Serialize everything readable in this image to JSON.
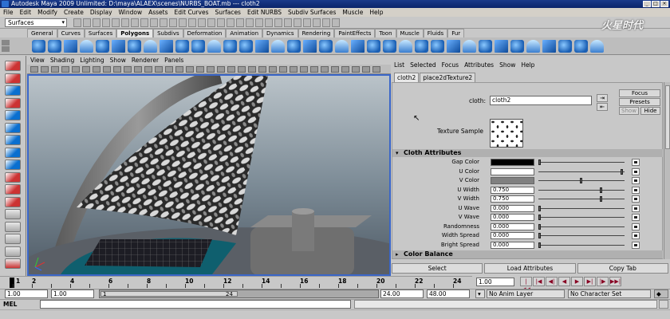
{
  "window": {
    "title": "Autodesk Maya 2009 Unlimited: D:\\maya\\ALAEX\\scenes\\NURBS_BOAT.mb  ---  cloth2"
  },
  "main_menu": [
    "File",
    "Edit",
    "Modify",
    "Create",
    "Display",
    "Window",
    "Assets",
    "Edit Curves",
    "Surfaces",
    "Edit NURBS",
    "Subdiv Surfaces",
    "Muscle",
    "Help"
  ],
  "menu_set": "Surfaces",
  "logo_text": "火星时代",
  "shelf_tabs": [
    "General",
    "Curves",
    "Surfaces",
    "Polygons",
    "Subdivs",
    "Deformation",
    "Animation",
    "Dynamics",
    "Rendering",
    "PaintEffects",
    "Toon",
    "Muscle",
    "Fluids",
    "Fur"
  ],
  "shelf_active": "Polygons",
  "panel_menu": [
    "View",
    "Shading",
    "Lighting",
    "Show",
    "Renderer",
    "Panels"
  ],
  "attr_editor": {
    "menu": [
      "List",
      "Selected",
      "Focus",
      "Attributes",
      "Show",
      "Help"
    ],
    "tabs": [
      "cloth2",
      "place2dTexture2"
    ],
    "active_tab": "cloth2",
    "node_label": "cloth:",
    "node_name": "cloth2",
    "buttons": {
      "focus": "Focus",
      "presets": "Presets",
      "show": "Show",
      "hide": "Hide"
    },
    "texture_sample_label": "Texture Sample",
    "sections": {
      "cloth_attributes": "Cloth Attributes",
      "color_balance": "Color Balance"
    },
    "attributes": [
      {
        "label": "Gap Color",
        "type": "color",
        "color": "#000000",
        "slider": 0.0
      },
      {
        "label": "U Color",
        "type": "color",
        "color": "#ffffff",
        "slider": 1.0
      },
      {
        "label": "V Color",
        "type": "color",
        "color": "#808080",
        "slider": 0.5
      },
      {
        "label": "U Width",
        "type": "value",
        "value": "0.750",
        "slider": 0.75
      },
      {
        "label": "V Width",
        "type": "value",
        "value": "0.750",
        "slider": 0.75
      },
      {
        "label": "U Wave",
        "type": "value",
        "value": "0.000",
        "slider": 0.0
      },
      {
        "label": "V Wave",
        "type": "value",
        "value": "0.000",
        "slider": 0.0
      },
      {
        "label": "Randomness",
        "type": "value",
        "value": "0.000",
        "slider": 0.0
      },
      {
        "label": "Width Spread",
        "type": "value",
        "value": "0.000",
        "slider": 0.0
      },
      {
        "label": "Bright Spread",
        "type": "value",
        "value": "0.000",
        "slider": 0.0
      }
    ],
    "bottom_buttons": [
      "Select",
      "Load Attributes",
      "Copy Tab"
    ]
  },
  "time_slider": {
    "ticks": [
      "2",
      "4",
      "6",
      "8",
      "10",
      "12",
      "14",
      "16",
      "18",
      "20",
      "22",
      "24"
    ],
    "current_first": "1",
    "current_time": "1.00"
  },
  "playback_buttons": [
    "|◀◀",
    "|◀",
    "◀|",
    "◀",
    "▶",
    "▶|",
    "|▶",
    "▶▶|"
  ],
  "range": {
    "start": "1.00",
    "playback_start": "1.00",
    "bar_start": "1",
    "bar_end": "24",
    "playback_end": "24.00",
    "end": "48.00",
    "anim_layer": "No Anim Layer",
    "character_set": "No Character Set"
  },
  "command_line": {
    "label": "MEL"
  }
}
